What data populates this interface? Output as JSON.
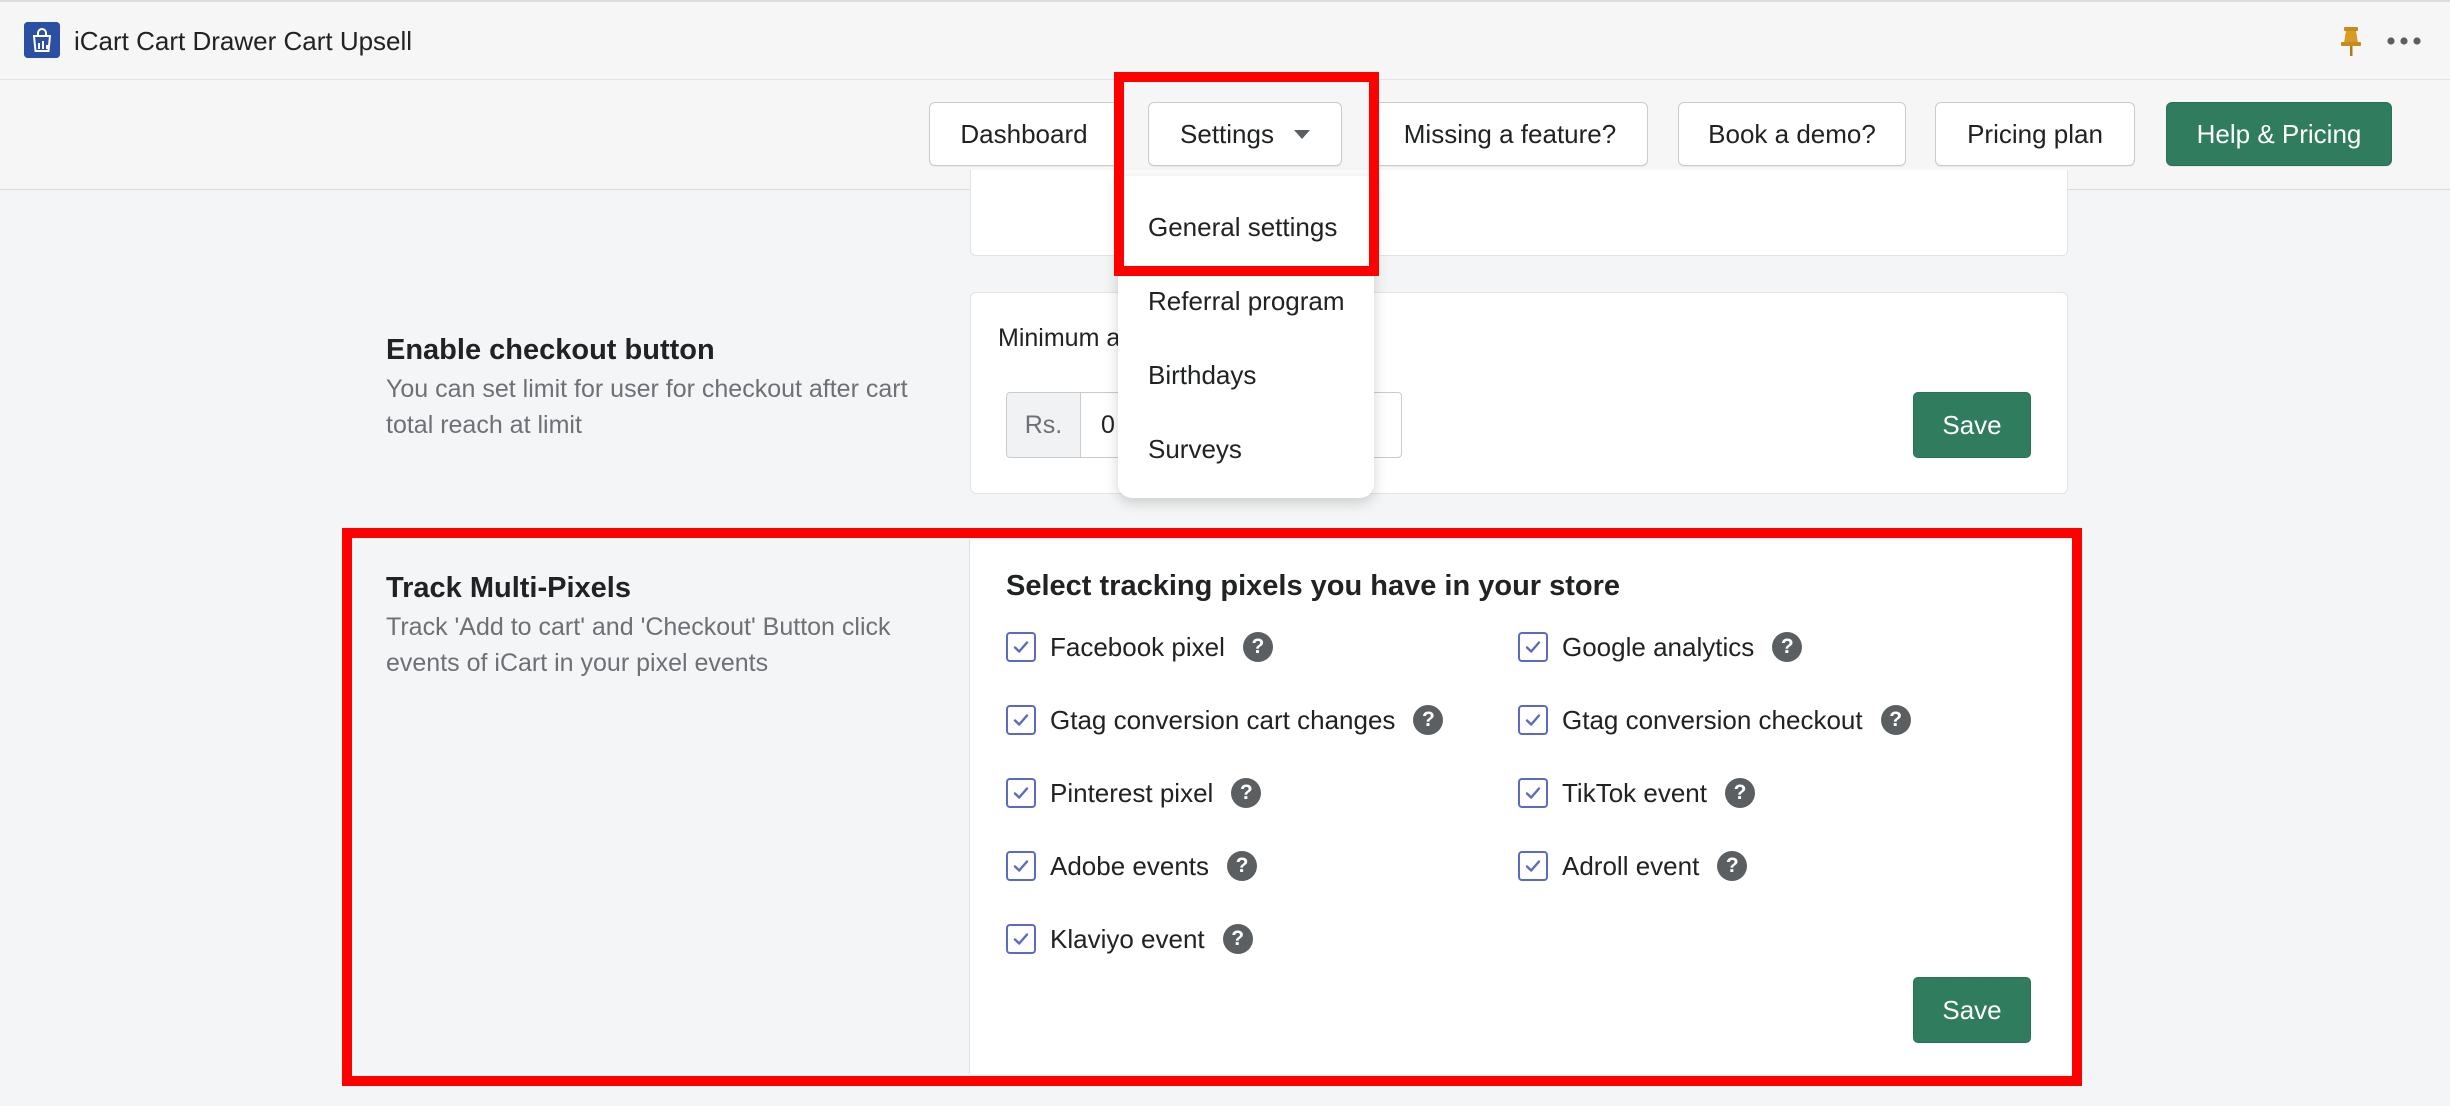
{
  "app": {
    "title": "iCart Cart Drawer Cart Upsell",
    "logo_icon": "shopping-bag-icon",
    "pin_icon": "pin-icon",
    "more_icon": "more-horizontal-icon"
  },
  "nav": {
    "dashboard": "Dashboard",
    "settings": "Settings",
    "missing_feature": "Missing a feature?",
    "book_demo": "Book a demo?",
    "pricing_plan": "Pricing plan",
    "help_pricing": "Help & Pricing"
  },
  "settings_menu": {
    "items": [
      "General settings",
      "Referral program",
      "Birthdays",
      "Surveys"
    ]
  },
  "checkout_section": {
    "title": "Enable checkout button",
    "description": "You can set limit for user for checkout after cart total reach at limit",
    "field_label": "Minimum a",
    "currency_prefix": "Rs.",
    "value": "0",
    "save_label": "Save"
  },
  "pixels_section": {
    "title": "Track Multi-Pixels",
    "description": "Track 'Add to cart' and 'Checkout' Button click events of iCart in your pixel events",
    "heading": "Select tracking pixels you have in your store",
    "help_glyph": "?",
    "pixels": [
      {
        "label": "Facebook pixel",
        "checked": true
      },
      {
        "label": "Google analytics",
        "checked": true
      },
      {
        "label": "Gtag conversion cart changes",
        "checked": true
      },
      {
        "label": "Gtag conversion checkout",
        "checked": true
      },
      {
        "label": "Pinterest pixel",
        "checked": true
      },
      {
        "label": "TikTok event",
        "checked": true
      },
      {
        "label": "Adobe events",
        "checked": true
      },
      {
        "label": "Adroll event",
        "checked": true
      },
      {
        "label": "Klaviyo event",
        "checked": true
      }
    ],
    "save_label": "Save"
  },
  "colors": {
    "primary_green": "#2f7d5e",
    "highlight_red": "#ff0000",
    "checkbox_accent": "#5c6ac4"
  }
}
